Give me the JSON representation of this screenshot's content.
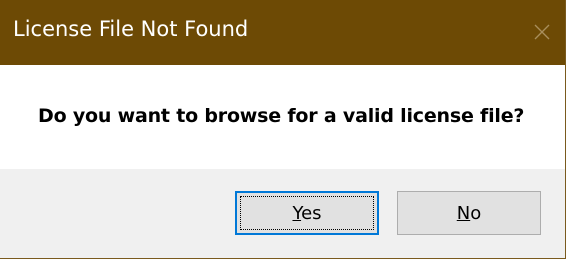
{
  "window": {
    "title": "License File Not Found",
    "titlebar_color": "#6d4a05",
    "close_icon": "close-icon"
  },
  "message": "Do you want to browse for a valid license file?",
  "buttons": {
    "yes": {
      "mnemonic": "Y",
      "rest": "es",
      "is_default": true
    },
    "no": {
      "mnemonic": "N",
      "rest": "o",
      "is_default": false
    }
  },
  "colors": {
    "focus_border": "#0078d7",
    "button_face": "#e1e1e1",
    "dialog_bg": "#f0f0f0",
    "message_bg": "#ffffff"
  }
}
